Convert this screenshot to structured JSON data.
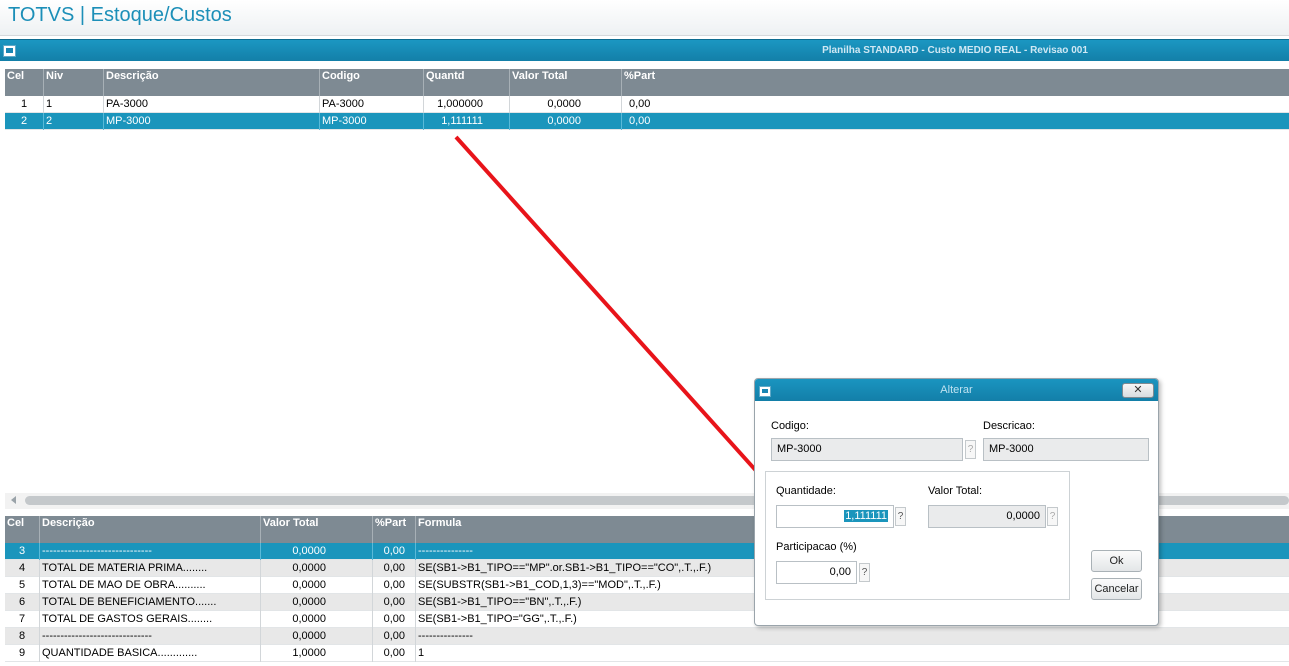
{
  "app": {
    "title": "TOTVS | Estoque/Custos"
  },
  "window": {
    "title": "Planilha STANDARD - Custo MEDIO REAL - Revisao 001"
  },
  "top_grid": {
    "headers": {
      "cel": "Cel",
      "niv": "Niv",
      "descricao": "Descrição",
      "codigo": "Codigo",
      "quantd": "Quantd",
      "valor_total": "Valor Total",
      "part": "%Part"
    },
    "rows": [
      {
        "cel": "1",
        "niv": "1",
        "descricao": "PA-3000",
        "codigo": "PA-3000",
        "quantd": "1,000000",
        "valor_total": "0,0000",
        "part": "0,00"
      },
      {
        "cel": "2",
        "niv": "2",
        "descricao": "MP-3000",
        "codigo": "MP-3000",
        "quantd": "1,111111",
        "valor_total": "0,0000",
        "part": "0,00"
      }
    ]
  },
  "bottom_grid": {
    "headers": {
      "cel": "Cel",
      "descricao": "Descrição",
      "valor_total": "Valor Total",
      "part": "%Part",
      "formula": "Formula"
    },
    "rows": [
      {
        "cel": "3",
        "descricao": "------------------------------",
        "valor_total": "0,0000",
        "part": "0,00",
        "formula": "---------------"
      },
      {
        "cel": "4",
        "descricao": "TOTAL DE MATERIA PRIMA........",
        "valor_total": "0,0000",
        "part": "0,00",
        "formula": "SE(SB1->B1_TIPO==\"MP\".or.SB1->B1_TIPO==\"CO\",.T.,.F.)"
      },
      {
        "cel": "5",
        "descricao": "TOTAL DE MAO DE OBRA..........",
        "valor_total": "0,0000",
        "part": "0,00",
        "formula": "SE(SUBSTR(SB1->B1_COD,1,3)==\"MOD\",.T.,.F.)"
      },
      {
        "cel": "6",
        "descricao": "TOTAL DE BENEFICIAMENTO.......",
        "valor_total": "0,0000",
        "part": "0,00",
        "formula": "SE(SB1->B1_TIPO==\"BN\",.T.,.F.)"
      },
      {
        "cel": "7",
        "descricao": "TOTAL DE GASTOS GERAIS........",
        "valor_total": "0,0000",
        "part": "0,00",
        "formula": "SE(SB1->B1_TIPO=\"GG\",.T.,.F.)"
      },
      {
        "cel": "8",
        "descricao": "------------------------------",
        "valor_total": "0,0000",
        "part": "0,00",
        "formula": "---------------"
      },
      {
        "cel": "9",
        "descricao": "QUANTIDADE BASICA.............",
        "valor_total": "1,0000",
        "part": "0,00",
        "formula": "1"
      }
    ]
  },
  "dialog": {
    "title": "Alterar",
    "close_label": "✕",
    "codigo_label": "Codigo:",
    "codigo_value": "MP-3000",
    "descricao_label": "Descricao:",
    "descricao_value": "MP-3000",
    "quantidade_label": "Quantidade:",
    "quantidade_value": "1,111111",
    "valor_total_label": "Valor Total:",
    "valor_total_value": "0,0000",
    "participacao_label": "Participacao (%)",
    "participacao_value": "0,00",
    "help_glyph": "?",
    "ok_label": "Ok",
    "cancel_label": "Cancelar"
  },
  "colors": {
    "accent": "#1b95bc",
    "header_gray": "#7e8a93",
    "annotation_arrow": "#e8141a"
  }
}
